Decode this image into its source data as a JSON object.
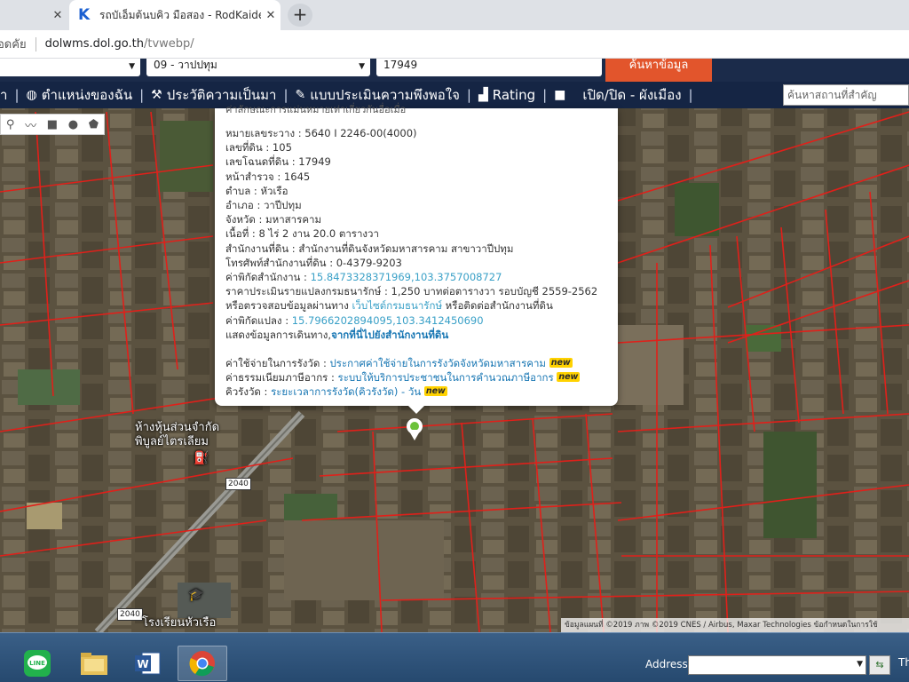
{
  "browser": {
    "tabs": [
      {
        "title": "รถบัเอ็มต้นบคิว มือสอง - RodKaidee",
        "active": true,
        "favicon": "K"
      }
    ],
    "new_tab_symbol": "+",
    "close_symbol": "✕",
    "insecure_label": "อดคัย",
    "url_host": "dolwms.dol.go.th",
    "url_path": "/tvwebp/"
  },
  "search_row": {
    "select_province": "",
    "select_district": "09 - วาปปทุม",
    "parcel_input": "17949",
    "search_button": "ค้นหาข้อมูล"
  },
  "toolbar": {
    "items": [
      {
        "label": "ำ",
        "icon": ""
      },
      {
        "label": "ตำแหน่งของฉัน",
        "icon": "globe-icon"
      },
      {
        "label": "ประวัติความเป็นมา",
        "icon": "tools-icon"
      },
      {
        "label": "แบบประเมินความพึงพอใจ",
        "icon": "edit-form-icon"
      },
      {
        "label": "Rating",
        "icon": "chart-icon"
      },
      {
        "label": "เปิด/ปิด - ผังเมือง",
        "icon": "checkbox-icon"
      }
    ],
    "place_search_placeholder": "ค้นหาสถานที่สำคัญ"
  },
  "popup": {
    "cut_text": "ค่าลักษณะการแม่นหมายเท่าเกี่ยวกันอื่อเมื่อ",
    "sheet": "หมายเลขระวาง : 5640 I 2246-00(4000)",
    "land_no": "เลขที่ดิน : 105",
    "deed_no": "เลขโฉนดที่ดิน : 17949",
    "survey_page": "หน้าสำรวจ : 1645",
    "subdistrict": "ตำบล : หัวเรือ",
    "district": "อำเภอ : วาปีปทุม",
    "province": "จังหวัด : มหาสารคาม",
    "area": "เนื้อที่ : 8 ไร่ 2 งาน 20.0 ตารางวา",
    "office": "สำนักงานที่ดิน : สำนักงานที่ดินจังหวัดมหาสารคาม สาขาวาปีปทุม",
    "phone": "โทรศัพท์สำนักงานที่ดิน : 0-4379-9203",
    "office_coord_label": "ค่าพิกัดสำนักงาน : ",
    "office_coord": "15.8473328371969,103.3757008727",
    "appraisal": "ราคาประเมินรายแปลงกรมธนารักษ์ : 1,250 บาทต่อตารางวา รอบบัญชี 2559-2562",
    "check_prefix": "หรือตรวจสอบข้อมูลผ่านทาง ",
    "check_link": "เว็บไซต์กรมธนารักษ์",
    "check_suffix": " หรือติดต่อสำนักงานที่ดิน",
    "parcel_coord_label": "ค่าพิกัดแปลง : ",
    "parcel_coord": "15.7966202894095,103.3412450690",
    "route_prefix": "แสดงข้อมูลการเดินทาง,",
    "route_link": "จากที่นี่ไปยังสำนักงานที่ดิน",
    "fee_label": "ค่าใช้จ่ายในการรังวัด : ",
    "fee_link": "ประกาศค่าใช้จ่ายในการรังวัดจังหวัดมหาสารคาม",
    "tax_label": "ค่าธรรมเนียมภาษีอากร : ",
    "tax_link": "ระบบให้บริการประชาชนในการคำนวณภาษีอากร",
    "queue_label": "คิวรังวัด : ",
    "queue_link": "ระยะเวลาการรังวัด(คิวรังวัด) - วัน",
    "new_badge": "new"
  },
  "map": {
    "labels": {
      "shop_line1": "ห้างหุ้นส่วนจำกัด",
      "shop_line2": "พิบูลย์ไตรเลียม",
      "school": "โรงเรียนหัวเรือ",
      "road_2040_a": "2040",
      "road_2040_b": "2040"
    },
    "attribution": "ข้อมูลแผนที่ ©2019 ภาพ ©2019 CNES / Airbus, Maxar Technologies   ข้อกำหนดในการใช้"
  },
  "taskbar": {
    "apps": [
      "line-app-icon",
      "file-explorer-icon",
      "word-app-icon",
      "chrome-app-icon"
    ],
    "address_label": "Address",
    "clock": "Th"
  },
  "colors": {
    "toolbar_bg": "#152544",
    "search_button": "#e2552c",
    "parcel_line": "#e0201a",
    "link": "#39a0c7",
    "new_badge": "#ffd200"
  }
}
